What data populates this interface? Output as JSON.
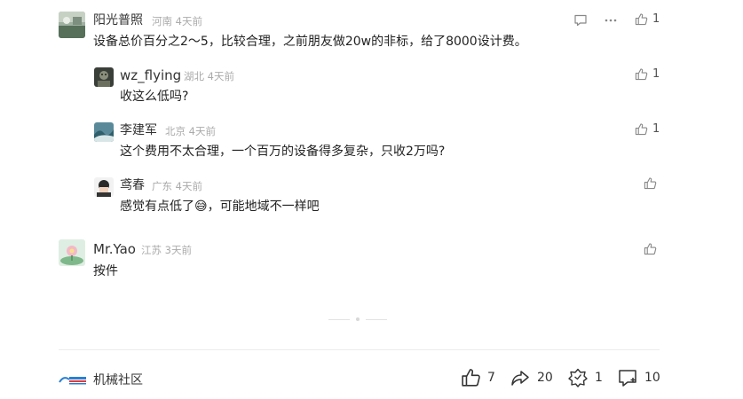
{
  "comments": [
    {
      "author": "阳光普照",
      "location": "河南",
      "time": "4天前",
      "text": "设备总价百分之2～5，比较合理，之前朋友做20w的非标，给了8000设计费。",
      "likes": "1"
    },
    {
      "author": "wz_flying",
      "location": "湖北",
      "time": "4天前",
      "text": "收这么低吗?",
      "likes": "1"
    },
    {
      "author": "李建军",
      "location": "北京",
      "time": "4天前",
      "text": "这个费用不太合理，一个百万的设备得多复杂，只收2万吗?",
      "likes": "1"
    },
    {
      "author": "鸢春",
      "location": "广东",
      "time": "4天前",
      "text_before": "感觉有点低了",
      "emoji": "😅",
      "text_after": "，可能地域不一样吧",
      "likes": ""
    },
    {
      "author": "Mr.Yao",
      "location": "江苏",
      "time": "3天前",
      "text": "按件",
      "likes": ""
    }
  ],
  "footer": {
    "community_name": "机械社区",
    "likes": "7",
    "shares": "20",
    "favorites": "1",
    "comments": "10"
  },
  "colors": {
    "muted": "#aaaaaa",
    "icon": "#888888",
    "divider": "#ececec"
  },
  "icons": [
    "comment-icon",
    "more-icon",
    "thumb-up-icon",
    "share-icon",
    "favorite-icon",
    "comment-add-icon"
  ]
}
